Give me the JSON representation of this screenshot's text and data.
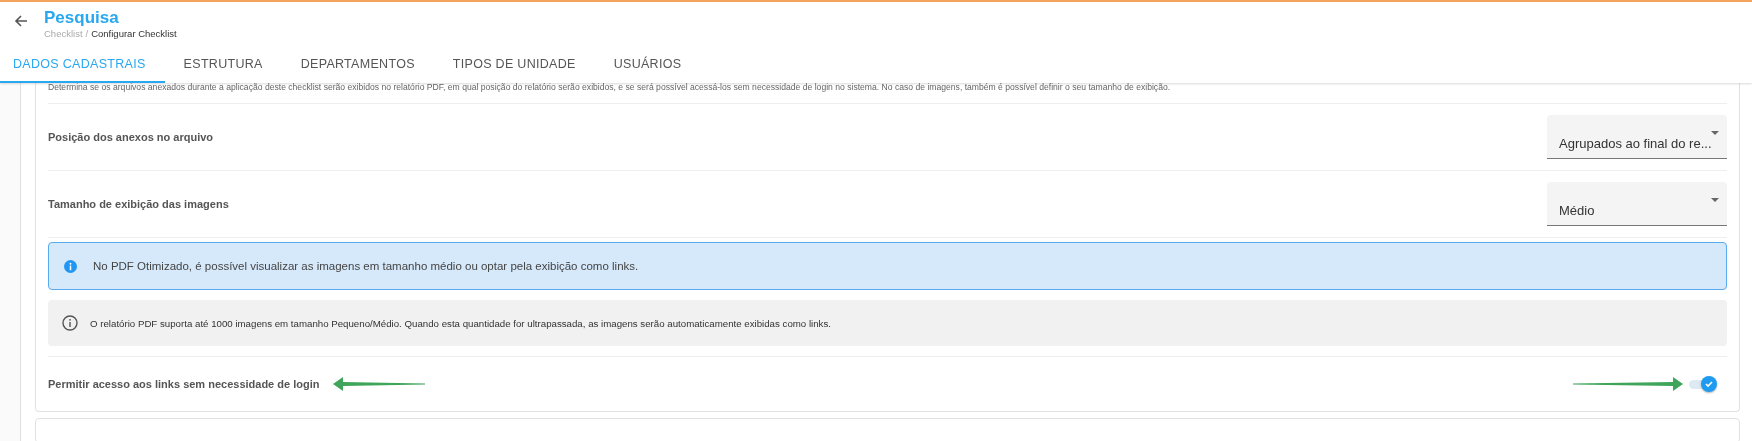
{
  "header": {
    "title": "Pesquisa",
    "breadcrumb": [
      "Checklist",
      "Configurar Checklist"
    ],
    "breadcrumb_separator": "/"
  },
  "tabs": [
    {
      "label": "DADOS CADASTRAIS",
      "selected": true
    },
    {
      "label": "ESTRUTURA",
      "selected": false
    },
    {
      "label": "DEPARTAMENTOS",
      "selected": false
    },
    {
      "label": "TIPOS DE UNIDADE",
      "selected": false
    },
    {
      "label": "USUÁRIOS",
      "selected": false
    }
  ],
  "description": "Determina se os arquivos anexados durante a aplicação deste checklist serão exibidos no relatório PDF, em qual posição do relatório serão exibidos, e se será possível acessá-los sem necessidade de login no sistema. No caso de imagens, também é possível definir o seu tamanho de exibição.",
  "settings": [
    {
      "kind": "select",
      "label": "Posição dos anexos no arquivo",
      "value": "Agrupados ao final do re..."
    },
    {
      "kind": "select",
      "label": "Tamanho de exibição das imagens",
      "value": "Médio"
    },
    {
      "kind": "info",
      "text": "No PDF Otimizado, é possível visualizar as imagens em tamanho médio ou optar pela exibição como links."
    },
    {
      "kind": "note",
      "text": "O relatório PDF suporta até 1000 imagens em tamanho Pequeno/Médio. Quando esta quantidade for ultrapassada, as imagens serão automaticamente exibidas como links."
    },
    {
      "kind": "toggle",
      "label": "Permitir acesso aos links sem necessidade de login",
      "on": true
    }
  ]
}
